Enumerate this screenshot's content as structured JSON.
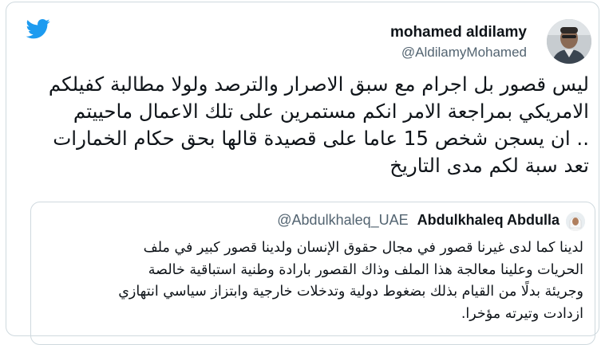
{
  "tweet": {
    "author": {
      "name": "mohamed aldilamy",
      "handle": "@AldilamyMohamed",
      "avatar": "avatar"
    },
    "text_lines": [
      "ليس قصور بل اجرام مع سبق الاصرار والترصد ولولا مطالبة كفيلكم",
      "الامريكي بمراجعة الامر انكم مستمرين على تلك الاعمال ماحييتم",
      ".. ان يسجن شخص 15 عاما على قصيدة قالها بحق حكام الخمارات",
      "تعد سبة لكم مدى التاريخ"
    ],
    "brand_icon": "twitter-bird-icon"
  },
  "quoted": {
    "name": "Abdulkhaleq Abdulla",
    "handle": "@Abdulkhaleq_UAE",
    "avatar": "avatar",
    "text_lines": [
      "لدينا كما لدى غيرنا قصور في مجال حقوق الإنسان ولدينا قصور كبير في ملف",
      "الحريات وعلينا معالجة هذا الملف وذاك القصور بارادة وطنية استباقية خالصة",
      "وجريئة بدلًا من القيام بذلك بضغوط دولية وتدخلات خارجية وابتزاز سياسي انتهازي",
      "ازدادت وتيرته مؤخرا."
    ]
  },
  "colors": {
    "brand": "#1d9bf0",
    "text": "#0f1419",
    "secondary": "#536471",
    "border": "#cfd9de"
  }
}
